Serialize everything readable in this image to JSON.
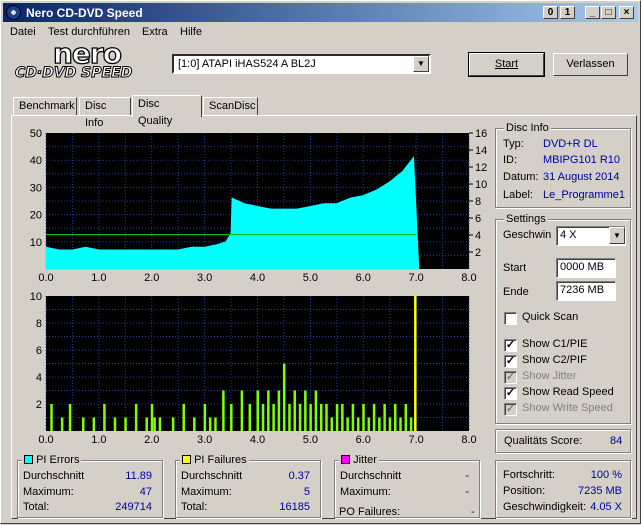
{
  "window": {
    "title": "Nero CD-DVD Speed",
    "controls": [
      "0",
      "1",
      "_",
      "□",
      "×"
    ]
  },
  "menu": [
    "Datei",
    "Test durchführen",
    "Extra",
    "Hilfe"
  ],
  "logo": {
    "line1": "nero",
    "line2": "CD·DVD SPEED"
  },
  "drive": {
    "selected": "[1:0]  ATAPI iHAS524   A BL2J"
  },
  "buttons": {
    "start": "Start",
    "exit": "Verlassen"
  },
  "tabs": [
    "Benchmark",
    "Disc Info",
    "Disc Quality",
    "ScanDisc"
  ],
  "active_tab": "Disc Quality",
  "disc_info": {
    "title": "Disc Info",
    "rows": [
      {
        "label": "Typ:",
        "value": "DVD+R DL"
      },
      {
        "label": "ID:",
        "value": "MBIPG101 R10"
      },
      {
        "label": "Datum:",
        "value": "31 August 2014"
      },
      {
        "label": "Label:",
        "value": "Le_Programme1"
      }
    ]
  },
  "settings": {
    "title": "Settings",
    "speed_label": "Geschwin",
    "speed_value": "4 X",
    "start_label": "Start",
    "start_value": "0000 MB",
    "end_label": "Ende",
    "end_value": "7236 MB",
    "checks": [
      {
        "label": "Quick Scan",
        "checked": false,
        "enabled": true
      },
      {
        "label": "Show C1/PIE",
        "checked": true,
        "enabled": true
      },
      {
        "label": "Show C2/PIF",
        "checked": true,
        "enabled": true
      },
      {
        "label": "Show Jitter",
        "checked": true,
        "enabled": false
      },
      {
        "label": "Show Read Speed",
        "checked": true,
        "enabled": true
      },
      {
        "label": "Show Write Speed",
        "checked": true,
        "enabled": false
      }
    ]
  },
  "quality": {
    "label": "Qualitäts Score:",
    "value": "84"
  },
  "progress": {
    "rows": [
      {
        "label": "Fortschritt:",
        "value": "100 %"
      },
      {
        "label": "Position:",
        "value": "7235 MB"
      },
      {
        "label": "Geschwindigkeit:",
        "value": "4.05 X"
      }
    ]
  },
  "pi_errors": {
    "title": "PI Errors",
    "color": "#00ffff",
    "rows": [
      {
        "label": "Durchschnitt",
        "value": "11.89"
      },
      {
        "label": "Maximum:",
        "value": "47"
      },
      {
        "label": "Total:",
        "value": "249714"
      }
    ]
  },
  "pi_failures": {
    "title": "PI Failures",
    "color": "#ffff00",
    "rows": [
      {
        "label": "Durchschnitt",
        "value": "0.37"
      },
      {
        "label": "Maximum:",
        "value": "5"
      },
      {
        "label": "Total:",
        "value": "16185"
      }
    ]
  },
  "jitter": {
    "title": "Jitter",
    "color": "#ff00ff",
    "rows": [
      {
        "label": "Durchschnitt",
        "value": "-"
      },
      {
        "label": "Maximum:",
        "value": "-"
      }
    ],
    "po_label": "PO Failures:",
    "po_value": "-"
  },
  "chart_data": [
    {
      "type": "area",
      "title": "",
      "xlabel": "",
      "ylabel": "",
      "xlim": [
        0,
        8
      ],
      "ylim": [
        0,
        50
      ],
      "y2lim": [
        0,
        16
      ],
      "x_ticks": [
        "0.0",
        "1.0",
        "2.0",
        "3.0",
        "4.0",
        "5.0",
        "6.0",
        "7.0",
        "8.0"
      ],
      "y_ticks": [
        "10",
        "20",
        "30",
        "40",
        "50"
      ],
      "y2_ticks": [
        "2",
        "4",
        "6",
        "8",
        "10",
        "12",
        "14",
        "16"
      ],
      "grid": true,
      "series": [
        {
          "color": "#00ffff",
          "x": [
            0.0,
            0.25,
            0.5,
            0.75,
            1.0,
            1.25,
            1.5,
            1.75,
            2.0,
            2.25,
            2.5,
            2.75,
            3.0,
            3.25,
            3.4,
            3.5,
            3.52,
            3.75,
            4.0,
            4.25,
            4.5,
            4.75,
            5.0,
            5.25,
            5.5,
            5.75,
            6.0,
            6.25,
            6.5,
            6.75,
            6.95,
            7.05
          ],
          "values": [
            8,
            7,
            7,
            8,
            7,
            7,
            7,
            7,
            7,
            7,
            7,
            8,
            8,
            9,
            10,
            13,
            26,
            24,
            23,
            22,
            22,
            22,
            23,
            24,
            24,
            26,
            27,
            29,
            32,
            36,
            41,
            0
          ]
        },
        {
          "color": "#00c000",
          "x": [
            0.0,
            7.0
          ],
          "values": [
            4.05,
            4.05
          ]
        }
      ]
    },
    {
      "type": "bar",
      "title": "",
      "xlabel": "",
      "ylabel": "",
      "xlim": [
        0,
        8
      ],
      "ylim": [
        0,
        10
      ],
      "x_ticks": [
        "0.0",
        "1.0",
        "2.0",
        "3.0",
        "4.0",
        "5.0",
        "6.0",
        "7.0",
        "8.0"
      ],
      "y_ticks": [
        "2",
        "4",
        "6",
        "8",
        "10"
      ],
      "grid": true,
      "series": [
        {
          "color": "#80ff00",
          "x": [
            0.1,
            0.3,
            0.45,
            0.7,
            0.9,
            1.1,
            1.3,
            1.5,
            1.7,
            1.9,
            2.0,
            2.05,
            2.15,
            2.4,
            2.6,
            2.8,
            3.0,
            3.1,
            3.2,
            3.35,
            3.5,
            3.7,
            3.85,
            4.0,
            4.1,
            4.2,
            4.3,
            4.4,
            4.5,
            4.6,
            4.7,
            4.8,
            4.9,
            5.0,
            5.1,
            5.2,
            5.3,
            5.4,
            5.5,
            5.6,
            5.7,
            5.8,
            5.9,
            6.0,
            6.1,
            6.2,
            6.3,
            6.4,
            6.5,
            6.6,
            6.7,
            6.8,
            6.9,
            6.98
          ],
          "values": [
            2,
            1,
            2,
            1,
            1,
            2,
            1,
            1,
            2,
            1,
            2,
            1,
            1,
            1,
            2,
            1,
            2,
            1,
            1,
            3,
            2,
            3,
            2,
            3,
            2,
            3,
            2,
            3,
            5,
            2,
            3,
            2,
            3,
            2,
            3,
            2,
            2,
            1,
            2,
            2,
            1,
            2,
            1,
            2,
            1,
            2,
            1,
            2,
            1,
            2,
            1,
            2,
            1,
            10
          ]
        }
      ]
    }
  ]
}
